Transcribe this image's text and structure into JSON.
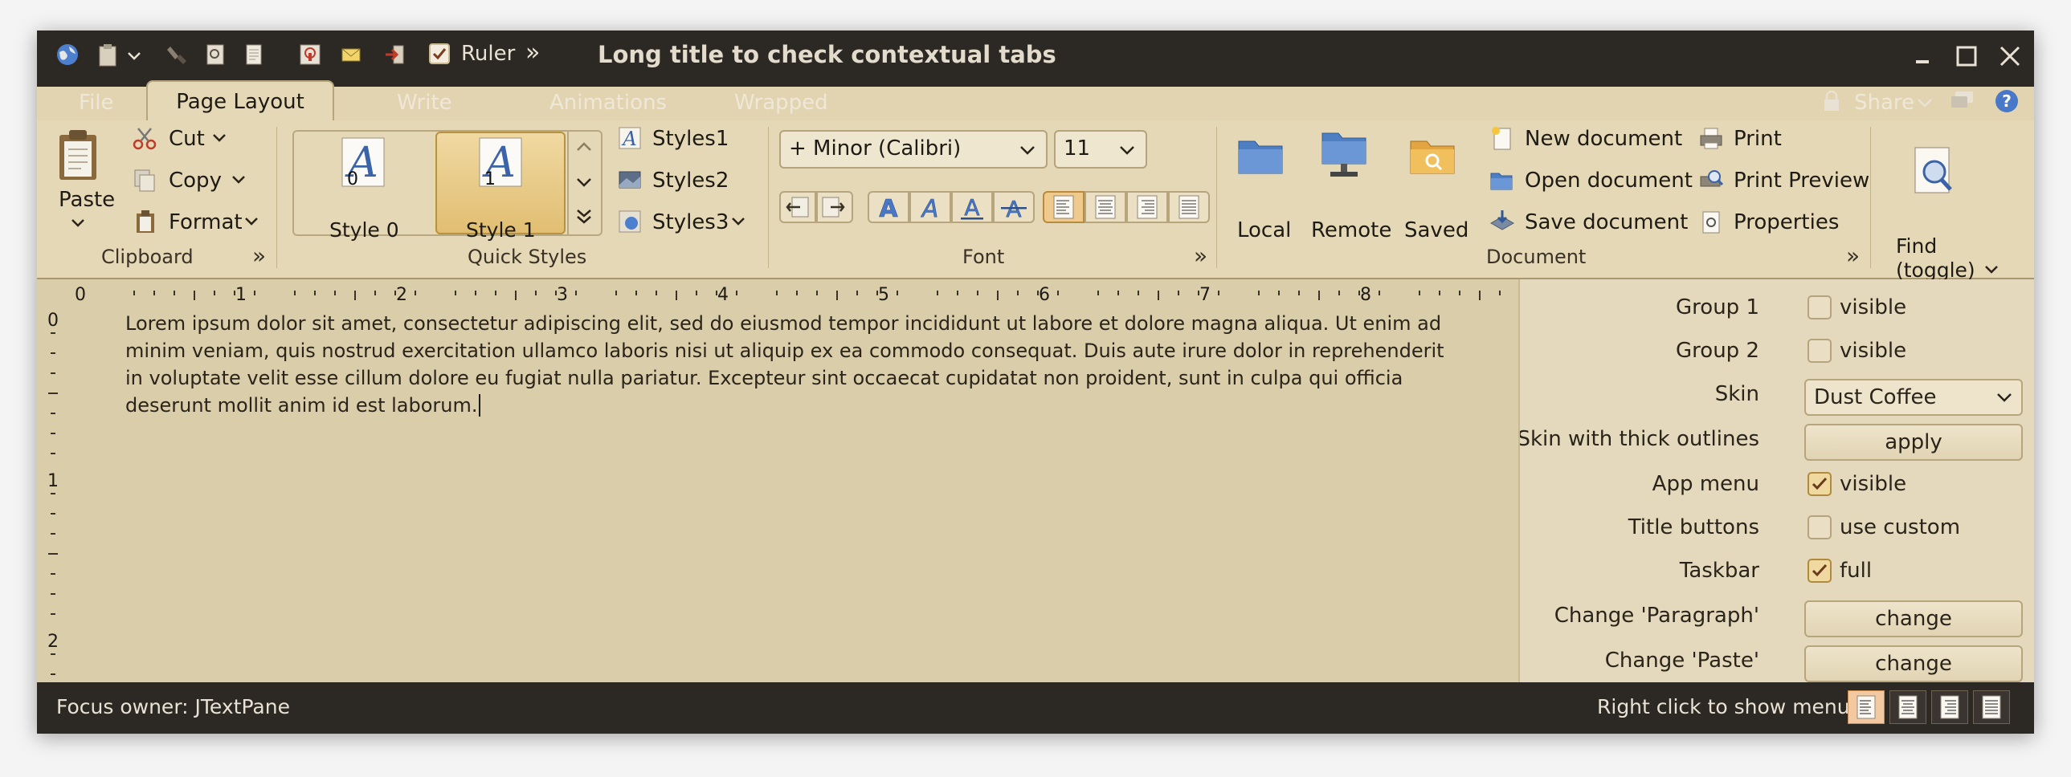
{
  "title_bar": {
    "window_title": "Long title to check contextual tabs",
    "ruler_label": "Ruler",
    "ruler_checked": true,
    "overflow_glyph": "»"
  },
  "tabs": [
    {
      "label": "File",
      "selected": false
    },
    {
      "label": "Page Layout",
      "selected": true
    },
    {
      "label": "Write",
      "selected": false
    },
    {
      "label": "Animations",
      "selected": false
    },
    {
      "label": "Wrapped",
      "selected": false
    }
  ],
  "taskbar_right": {
    "share_label": "Share"
  },
  "ribbon": {
    "clipboard": {
      "paste_label": "Paste",
      "cut_label": "Cut",
      "copy_label": "Copy",
      "format_label": "Format",
      "group_label": "Clipboard"
    },
    "quick_styles": {
      "style0_label": "Style 0",
      "style0_num": "0",
      "style1_label": "Style 1",
      "style1_num": "1",
      "styles1_label": "Styles1",
      "styles2_label": "Styles2",
      "styles3_label": "Styles3",
      "glyph": "A",
      "group_label": "Quick Styles"
    },
    "font": {
      "family_value": "+ Minor (Calibri)",
      "size_value": "11",
      "glyph": "A",
      "group_label": "Font"
    },
    "document": {
      "local_label": "Local",
      "remote_label": "Remote",
      "saved_label": "Saved",
      "new_label": "New document",
      "open_label": "Open document",
      "save_label": "Save document",
      "print_label": "Print",
      "print_preview_label": "Print Preview",
      "properties_label": "Properties",
      "group_label": "Document"
    },
    "find": {
      "label_line1": "Find",
      "label_line2": "(toggle)"
    },
    "expander_glyph": "»"
  },
  "ruler": {
    "h_numbers": [
      "0",
      "1",
      "2",
      "3",
      "4",
      "5",
      "6",
      "7",
      "8"
    ],
    "v_numbers": [
      "0",
      "1",
      "2"
    ]
  },
  "document_text": "Lorem ipsum dolor sit amet, consectetur adipiscing elit, sed do eiusmod tempor incididunt ut labore et dolore magna aliqua. Ut enim ad minim veniam, quis nostrud exercitation ullamco laboris nisi ut aliquip ex ea commodo consequat. Duis aute irure dolor in reprehenderit in voluptate velit esse cillum dolore eu fugiat nulla pariatur. Excepteur sint occaecat cupidatat non proident, sunt in culpa qui officia deserunt mollit anim id est laborum.",
  "side_panel": {
    "group1_label": "Group 1",
    "group1_check": "visible",
    "group1_checked": false,
    "group2_label": "Group 2",
    "group2_check": "visible",
    "group2_checked": false,
    "skin_label": "Skin",
    "skin_value": "Dust Coffee",
    "thick_label": "Skin with thick outlines",
    "thick_button": "apply",
    "appmenu_label": "App menu",
    "appmenu_check": "visible",
    "appmenu_checked": true,
    "titlebuttons_label": "Title buttons",
    "titlebuttons_check": "use custom",
    "titlebuttons_checked": false,
    "taskbar_label": "Taskbar",
    "taskbar_check": "full",
    "taskbar_checked": true,
    "paragraph_label": "Change 'Paragraph'",
    "paragraph_button": "change",
    "paste_label": "Change 'Paste'",
    "paste_button": "change"
  },
  "status_bar": {
    "focus_label": "Focus owner:  JTextPane",
    "hint": "Right click to show menu"
  },
  "colors": {
    "chrome_dark": "#2c2824",
    "ribbon_bg": "#e4d8b6",
    "document_bg": "#dacdaa",
    "selected_style": "#e1be72",
    "accent_blue": "#4a78c8"
  }
}
